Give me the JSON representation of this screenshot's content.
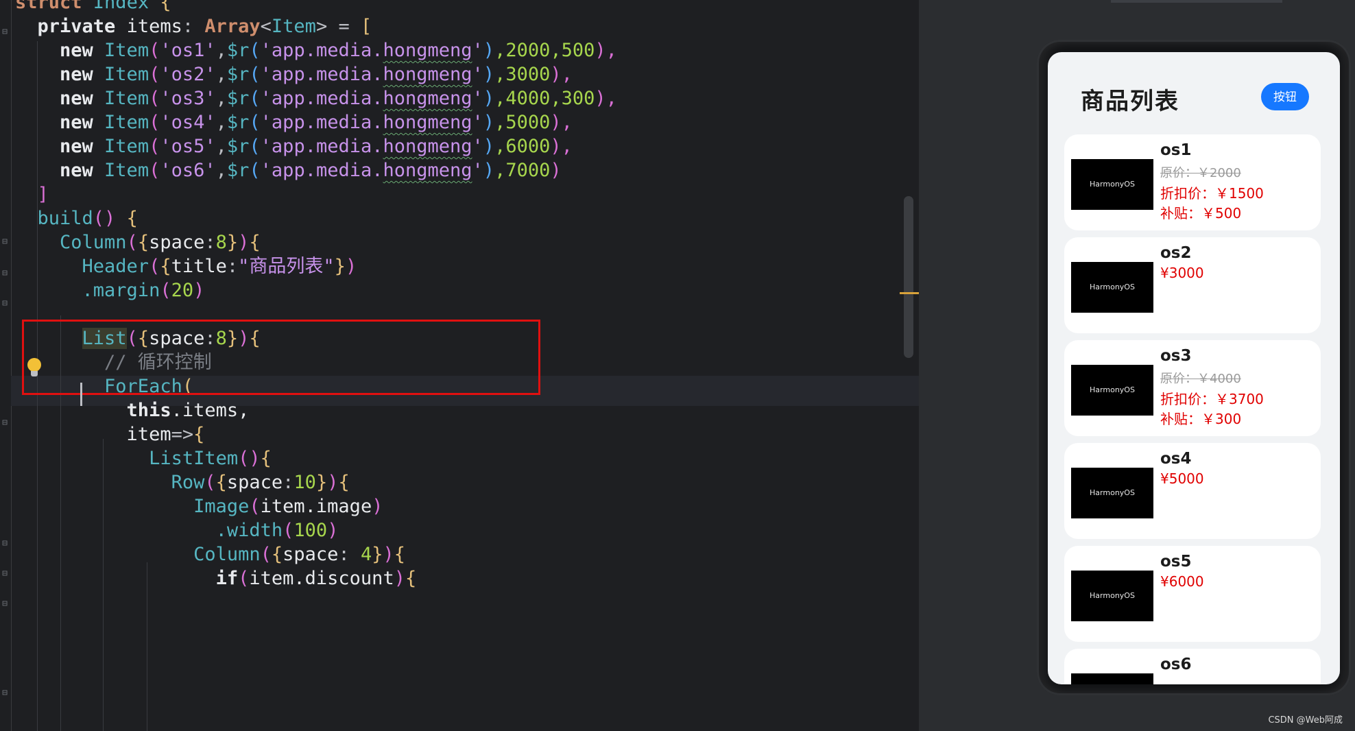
{
  "editor": {
    "code_lines": [
      {
        "parts": [
          {
            "t": "struct ",
            "c": "kw"
          },
          {
            "t": "Index",
            "c": "cls"
          },
          {
            "t": " {",
            "c": "br1"
          }
        ]
      },
      {
        "parts": [
          {
            "t": "  private ",
            "c": "kwb"
          },
          {
            "t": "items",
            "c": "prop"
          },
          {
            "t": ": ",
            "c": "plain"
          },
          {
            "t": "Array",
            "c": "kw"
          },
          {
            "t": "<",
            "c": "plain"
          },
          {
            "t": "Item",
            "c": "cls"
          },
          {
            "t": "> = ",
            "c": "plain"
          },
          {
            "t": "[",
            "c": "br1"
          }
        ]
      },
      {
        "parts": [
          {
            "t": "    new ",
            "c": "kwb"
          },
          {
            "t": "Item",
            "c": "cls"
          },
          {
            "t": "(",
            "c": "br2"
          },
          {
            "t": "'os1'",
            "c": "strp"
          },
          {
            "t": ",",
            "c": "plain"
          },
          {
            "t": "$r",
            "c": "cls"
          },
          {
            "t": "(",
            "c": "br3"
          },
          {
            "t": "'app.media.",
            "c": "strp"
          },
          {
            "t": "hongmeng",
            "c": "strp wavy"
          },
          {
            "t": "'",
            "c": "strp"
          },
          {
            "t": ")",
            "c": "br3"
          },
          {
            "t": ",2000,500",
            "c": "numg"
          },
          {
            "t": "),",
            "c": "br2"
          }
        ]
      },
      {
        "parts": [
          {
            "t": "    new ",
            "c": "kwb"
          },
          {
            "t": "Item",
            "c": "cls"
          },
          {
            "t": "(",
            "c": "br2"
          },
          {
            "t": "'os2'",
            "c": "strp"
          },
          {
            "t": ",",
            "c": "plain"
          },
          {
            "t": "$r",
            "c": "cls"
          },
          {
            "t": "(",
            "c": "br3"
          },
          {
            "t": "'app.media.",
            "c": "strp"
          },
          {
            "t": "hongmeng",
            "c": "strp wavy"
          },
          {
            "t": "'",
            "c": "strp"
          },
          {
            "t": ")",
            "c": "br3"
          },
          {
            "t": ",3000",
            "c": "numg"
          },
          {
            "t": "),",
            "c": "br2"
          }
        ]
      },
      {
        "parts": [
          {
            "t": "    new ",
            "c": "kwb"
          },
          {
            "t": "Item",
            "c": "cls"
          },
          {
            "t": "(",
            "c": "br2"
          },
          {
            "t": "'os3'",
            "c": "strp"
          },
          {
            "t": ",",
            "c": "plain"
          },
          {
            "t": "$r",
            "c": "cls"
          },
          {
            "t": "(",
            "c": "br3"
          },
          {
            "t": "'app.media.",
            "c": "strp"
          },
          {
            "t": "hongmeng",
            "c": "strp wavy"
          },
          {
            "t": "'",
            "c": "strp"
          },
          {
            "t": ")",
            "c": "br3"
          },
          {
            "t": ",4000,300",
            "c": "numg"
          },
          {
            "t": "),",
            "c": "br2"
          }
        ]
      },
      {
        "parts": [
          {
            "t": "    new ",
            "c": "kwb"
          },
          {
            "t": "Item",
            "c": "cls"
          },
          {
            "t": "(",
            "c": "br2"
          },
          {
            "t": "'os4'",
            "c": "strp"
          },
          {
            "t": ",",
            "c": "plain"
          },
          {
            "t": "$r",
            "c": "cls"
          },
          {
            "t": "(",
            "c": "br3"
          },
          {
            "t": "'app.media.",
            "c": "strp"
          },
          {
            "t": "hongmeng",
            "c": "strp wavy"
          },
          {
            "t": "'",
            "c": "strp"
          },
          {
            "t": ")",
            "c": "br3"
          },
          {
            "t": ",5000",
            "c": "numg"
          },
          {
            "t": "),",
            "c": "br2"
          }
        ]
      },
      {
        "parts": [
          {
            "t": "    new ",
            "c": "kwb"
          },
          {
            "t": "Item",
            "c": "cls"
          },
          {
            "t": "(",
            "c": "br2"
          },
          {
            "t": "'os5'",
            "c": "strp"
          },
          {
            "t": ",",
            "c": "plain"
          },
          {
            "t": "$r",
            "c": "cls"
          },
          {
            "t": "(",
            "c": "br3"
          },
          {
            "t": "'app.media.",
            "c": "strp"
          },
          {
            "t": "hongmeng",
            "c": "strp wavy"
          },
          {
            "t": "'",
            "c": "strp"
          },
          {
            "t": ")",
            "c": "br3"
          },
          {
            "t": ",6000",
            "c": "numg"
          },
          {
            "t": "),",
            "c": "br2"
          }
        ]
      },
      {
        "parts": [
          {
            "t": "    new ",
            "c": "kwb"
          },
          {
            "t": "Item",
            "c": "cls"
          },
          {
            "t": "(",
            "c": "br2"
          },
          {
            "t": "'os6'",
            "c": "strp"
          },
          {
            "t": ",",
            "c": "plain"
          },
          {
            "t": "$r",
            "c": "cls"
          },
          {
            "t": "(",
            "c": "br3"
          },
          {
            "t": "'app.media.",
            "c": "strp"
          },
          {
            "t": "hongmeng",
            "c": "strp wavy"
          },
          {
            "t": "'",
            "c": "strp"
          },
          {
            "t": ")",
            "c": "br3"
          },
          {
            "t": ",7000",
            "c": "numg"
          },
          {
            "t": ")",
            "c": "br2"
          }
        ]
      },
      {
        "parts": [
          {
            "t": "  ]",
            "c": "br2"
          }
        ]
      },
      {
        "parts": [
          {
            "t": "  build",
            "c": "cls"
          },
          {
            "t": "() ",
            "c": "br2"
          },
          {
            "t": "{",
            "c": "br1"
          }
        ]
      },
      {
        "parts": [
          {
            "t": "    Column",
            "c": "cls"
          },
          {
            "t": "(",
            "c": "br2"
          },
          {
            "t": "{",
            "c": "br1"
          },
          {
            "t": "space",
            "c": "prop"
          },
          {
            "t": ":",
            "c": "plain"
          },
          {
            "t": "8",
            "c": "numg"
          },
          {
            "t": "}",
            "c": "br1"
          },
          {
            "t": ")",
            "c": "br2"
          },
          {
            "t": "{",
            "c": "br1"
          }
        ]
      },
      {
        "parts": [
          {
            "t": "      Header",
            "c": "cls"
          },
          {
            "t": "(",
            "c": "br2"
          },
          {
            "t": "{",
            "c": "br1"
          },
          {
            "t": "title",
            "c": "prop"
          },
          {
            "t": ":",
            "c": "plain"
          },
          {
            "t": "\"商品列表\"",
            "c": "strp"
          },
          {
            "t": "}",
            "c": "br1"
          },
          {
            "t": ")",
            "c": "br2"
          }
        ]
      },
      {
        "parts": [
          {
            "t": "      .margin",
            "c": "cls"
          },
          {
            "t": "(",
            "c": "br2"
          },
          {
            "t": "20",
            "c": "numg"
          },
          {
            "t": ")",
            "c": "br2"
          }
        ]
      },
      {
        "parts": [
          {
            "t": "",
            "c": "plain"
          }
        ]
      },
      {
        "parts": [
          {
            "t": "      ",
            "c": "plain"
          },
          {
            "t": "List",
            "c": "cls listhl"
          },
          {
            "t": "(",
            "c": "br2"
          },
          {
            "t": "{",
            "c": "br1"
          },
          {
            "t": "space",
            "c": "prop"
          },
          {
            "t": ":",
            "c": "plain"
          },
          {
            "t": "8",
            "c": "numg"
          },
          {
            "t": "}",
            "c": "br1"
          },
          {
            "t": ")",
            "c": "br2"
          },
          {
            "t": "{",
            "c": "br1"
          }
        ]
      },
      {
        "parts": [
          {
            "t": "        // 循环控制",
            "c": "cmt"
          }
        ]
      },
      {
        "parts": [
          {
            "t": "        ForEach",
            "c": "cls"
          },
          {
            "t": "(",
            "c": "br1"
          }
        ]
      },
      {
        "parts": [
          {
            "t": "          this",
            "c": "kwb"
          },
          {
            "t": ".items,",
            "c": "prop"
          }
        ]
      },
      {
        "parts": [
          {
            "t": "          item",
            "c": "prop"
          },
          {
            "t": "=>",
            "c": "plain"
          },
          {
            "t": "{",
            "c": "br1"
          }
        ]
      },
      {
        "parts": [
          {
            "t": "            ListItem",
            "c": "cls"
          },
          {
            "t": "()",
            "c": "br2"
          },
          {
            "t": "{",
            "c": "br1"
          }
        ]
      },
      {
        "parts": [
          {
            "t": "              Row",
            "c": "cls"
          },
          {
            "t": "(",
            "c": "br2"
          },
          {
            "t": "{",
            "c": "br1"
          },
          {
            "t": "space",
            "c": "prop"
          },
          {
            "t": ":",
            "c": "plain"
          },
          {
            "t": "10",
            "c": "numg"
          },
          {
            "t": "}",
            "c": "br1"
          },
          {
            "t": ")",
            "c": "br2"
          },
          {
            "t": "{",
            "c": "br1"
          }
        ]
      },
      {
        "parts": [
          {
            "t": "                Image",
            "c": "cls"
          },
          {
            "t": "(",
            "c": "br2"
          },
          {
            "t": "item.image",
            "c": "prop"
          },
          {
            "t": ")",
            "c": "br2"
          }
        ]
      },
      {
        "parts": [
          {
            "t": "                  .width",
            "c": "cls"
          },
          {
            "t": "(",
            "c": "br2"
          },
          {
            "t": "100",
            "c": "numg"
          },
          {
            "t": ")",
            "c": "br2"
          }
        ]
      },
      {
        "parts": [
          {
            "t": "                Column",
            "c": "cls"
          },
          {
            "t": "(",
            "c": "br2"
          },
          {
            "t": "{",
            "c": "br1"
          },
          {
            "t": "space",
            "c": "prop"
          },
          {
            "t": ": ",
            "c": "plain"
          },
          {
            "t": "4",
            "c": "numg"
          },
          {
            "t": "}",
            "c": "br1"
          },
          {
            "t": ")",
            "c": "br2"
          },
          {
            "t": "{",
            "c": "br1"
          }
        ]
      },
      {
        "parts": [
          {
            "t": "                  if",
            "c": "kwb"
          },
          {
            "t": "(",
            "c": "br2"
          },
          {
            "t": "item.discount",
            "c": "prop"
          },
          {
            "t": ")",
            "c": "br2"
          },
          {
            "t": "{",
            "c": "br1"
          }
        ]
      }
    ]
  },
  "preview": {
    "header_title": "商品列表",
    "header_button": "按钮",
    "thumb_label": "HarmonyOS",
    "products": [
      {
        "name": "os1",
        "original": "原价：￥2000",
        "discount_price": "折扣价：￥1500",
        "subsidy": "补贴：￥500",
        "price": ""
      },
      {
        "name": "os2",
        "original": "",
        "discount_price": "",
        "subsidy": "",
        "price": "¥3000"
      },
      {
        "name": "os3",
        "original": "原价：￥4000",
        "discount_price": "折扣价：￥3700",
        "subsidy": "补贴：￥300",
        "price": ""
      },
      {
        "name": "os4",
        "original": "",
        "discount_price": "",
        "subsidy": "",
        "price": "¥5000"
      },
      {
        "name": "os5",
        "original": "",
        "discount_price": "",
        "subsidy": "",
        "price": "¥6000"
      },
      {
        "name": "os6",
        "original": "",
        "discount_price": "",
        "subsidy": "",
        "price": ""
      }
    ]
  },
  "watermark": "CSDN @Web阿成",
  "colors": {
    "accent_button": "#1678ff",
    "price_red": "#e00000",
    "highlight_box": "#e01010"
  }
}
